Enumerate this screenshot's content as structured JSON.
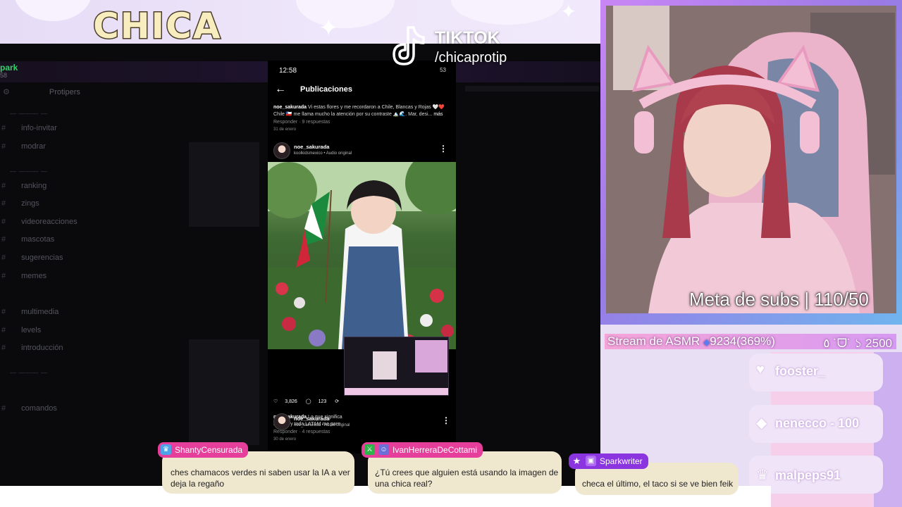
{
  "banner": {
    "title": "CHICA"
  },
  "tiktok": {
    "label": "TIKTOK",
    "handle": "/chicaprotip"
  },
  "discord": {
    "server_name": "park",
    "server_sub": "58",
    "server_row": "Protipers",
    "channels": [
      {
        "label": "info-invitar"
      },
      {
        "label": "modrar"
      },
      {
        "label": "ranking"
      },
      {
        "label": "zings"
      },
      {
        "label": "videoreacciones"
      },
      {
        "label": "mascotas"
      },
      {
        "label": "sugerencias"
      },
      {
        "label": "memes"
      },
      {
        "label": "multimedia"
      },
      {
        "label": "levels"
      },
      {
        "label": "introducción"
      },
      {
        "label": "comandos"
      }
    ]
  },
  "phone": {
    "time": "12:58",
    "status_right": "53",
    "title": "Publicaciones",
    "comment_user": "noe_sakurada",
    "comment_text": "Vi estas flores y me recordaron a Chile, Blancas y Rojas 🤍❤️ Chile 🇨🇱 me llama mucho la atención por su contraste 🏔️🌊. Mar, desi...",
    "comment_more": "más",
    "comment_meta": "Responder · 9 respuestas",
    "comment_date": "31 de enero",
    "post_user": "noe_sakurada",
    "post_audio": "koolkidsmexico • Audio original",
    "likes": "3,826",
    "comments": "123",
    "caption_user": "noe_sakurada",
    "caption_text": "Lo que significa México y toda LATAM me pare",
    "caption_meta": "Responder · 4 respuestas",
    "caption_date": "30 de enero",
    "post2_user": "noe_sakurada",
    "post2_audio": "noe_sakurada • Audio original"
  },
  "webcam": {
    "goal": "Meta de subs | 110/50"
  },
  "stats": {
    "stream": "Stream de ASMR",
    "points": "9234(369%)",
    "right": "٥ ˙ᗜ˙ ১ 2500"
  },
  "supporters": [
    {
      "name": "fooster_",
      "icon": "heart-icon"
    },
    {
      "name": "nenecco - 100",
      "icon": "drop-icon"
    },
    {
      "name": "malpeps91",
      "icon": "crown-icon"
    }
  ],
  "chat": [
    {
      "user": "ShantyCensurada",
      "badge": "crown-icon",
      "text": "ches chamacos verdes ni saben usar la IA a ver deja la regaño"
    },
    {
      "user": "IvanHerreraDeCottami",
      "badge": "sword-icon",
      "text": "¿Tú crees que alguien está usando la imagen de una chica real?"
    },
    {
      "user": "Sparkwriter",
      "badge": "star-icon",
      "text": "checa el último, el taco si se ve bien feik"
    }
  ],
  "colors": {
    "banner": "#e6dcf6",
    "accent_pink": "#e63e9b",
    "accent_purple": "#8a35e0",
    "bubble": "#f0e7cf"
  }
}
